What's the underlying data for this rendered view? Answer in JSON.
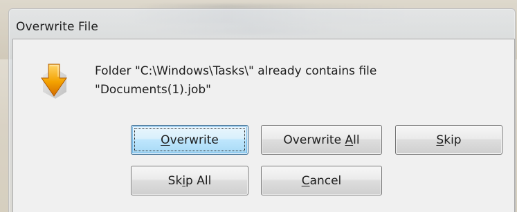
{
  "dialog": {
    "title": "Overwrite File",
    "message_line1": "Folder \"C:\\Windows\\Tasks\\\" already contains file",
    "message_line2": "\"Documents(1).job\""
  },
  "buttons": {
    "overwrite": {
      "pre": "",
      "mnemonic": "O",
      "post": "verwrite"
    },
    "overwrite_all": {
      "pre": "Overwrite ",
      "mnemonic": "A",
      "post": "ll"
    },
    "skip": {
      "pre": "",
      "mnemonic": "S",
      "post": "kip"
    },
    "skip_all": {
      "pre": "Sk",
      "mnemonic": "i",
      "post": "p All"
    },
    "cancel": {
      "pre": "",
      "mnemonic": "C",
      "post": "ancel"
    }
  },
  "icons": {
    "dialog_icon": "overwrite-download-arrow-icon"
  },
  "colors": {
    "icon_orange": "#f4a300",
    "icon_orange_dark": "#d46c00",
    "button_default_border": "#2c628b"
  }
}
